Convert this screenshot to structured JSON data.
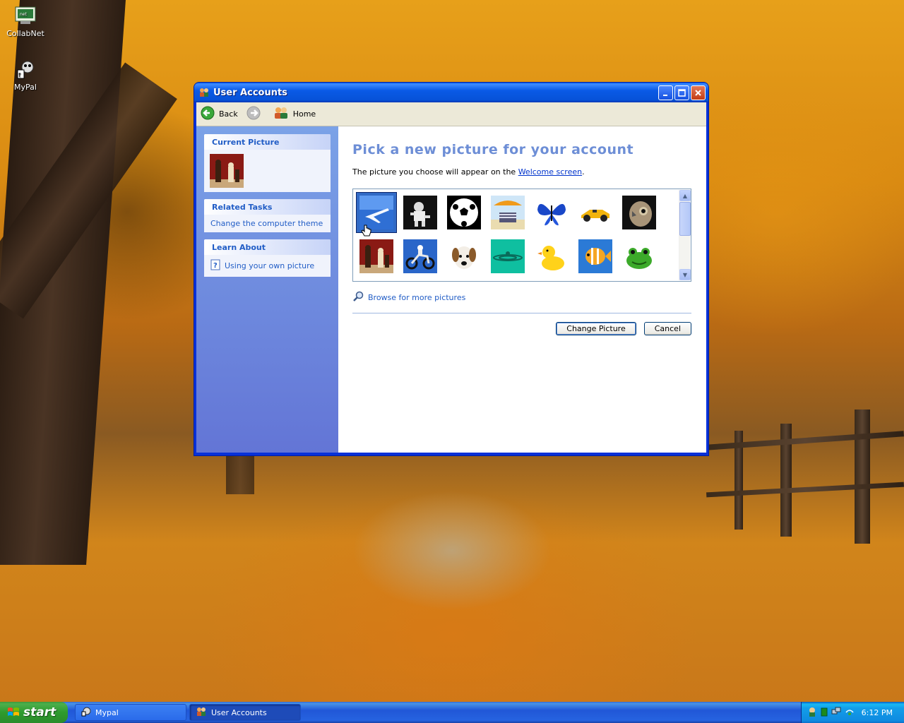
{
  "desktop": {
    "icons": [
      {
        "label": "CollabNet",
        "icon": "collabnet-icon"
      },
      {
        "label": "MyPal",
        "icon": "mypal-icon"
      }
    ]
  },
  "window": {
    "title": "User Accounts",
    "toolbar": {
      "back_label": "Back",
      "home_label": "Home"
    },
    "left": {
      "current_picture_heading": "Current Picture",
      "related_tasks_heading": "Related Tasks",
      "related_tasks_item": "Change the computer theme",
      "learn_about_heading": "Learn About",
      "learn_about_item": "Using your own picture"
    },
    "main": {
      "title": "Pick a new picture for your account",
      "desc_prefix": "The picture you choose will appear on the ",
      "desc_link": "Welcome screen",
      "desc_suffix": ".",
      "pictures": [
        "airplane",
        "astronaut",
        "soccer-ball",
        "beach-chair",
        "butterfly",
        "race-car",
        "owl",
        "chess",
        "dirt-bike",
        "dog",
        "teal-ripple",
        "rubber-duck",
        "fish",
        "frog"
      ],
      "selected_picture": "airplane",
      "browse_label": "Browse for more pictures",
      "change_button": "Change Picture",
      "cancel_button": "Cancel"
    }
  },
  "taskbar": {
    "start_label": "start",
    "tasks": [
      {
        "label": "Mypal",
        "active": false
      },
      {
        "label": "User Accounts",
        "active": true
      }
    ],
    "clock": "6:12 PM"
  },
  "colors": {
    "title_blue": "#0a5ae6",
    "link_blue": "#215dc6",
    "heading_blue": "#6d8ed6",
    "start_green": "#2e9b2e"
  }
}
